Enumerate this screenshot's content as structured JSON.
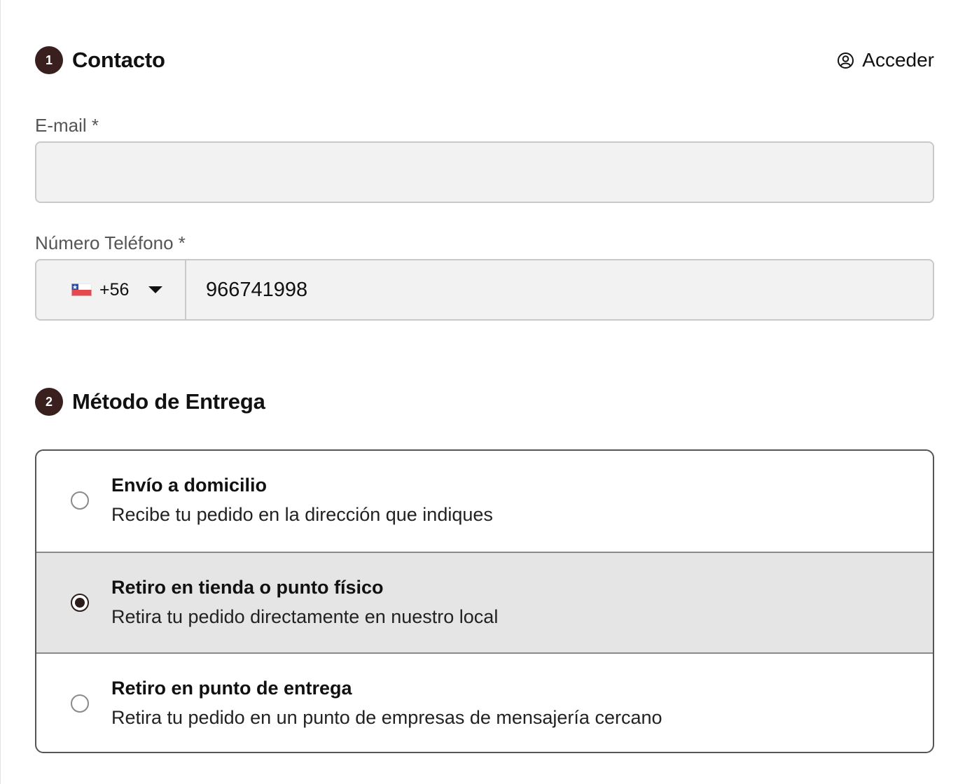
{
  "contact": {
    "step": "1",
    "title": "Contacto",
    "login_label": "Acceder"
  },
  "email": {
    "label": "E-mail *",
    "value": "",
    "placeholder": ""
  },
  "phone": {
    "label": "Número Teléfono *",
    "country_code": "+56",
    "country_flag": "chile-flag-icon",
    "value": "966741998"
  },
  "delivery": {
    "step": "2",
    "title": "Método de Entrega",
    "options": [
      {
        "title": "Envío a domicilio",
        "description": "Recibe tu pedido en la dirección que indiques",
        "selected": false
      },
      {
        "title": "Retiro en tienda o punto físico",
        "description": "Retira tu pedido directamente en nuestro local",
        "selected": true
      },
      {
        "title": "Retiro en punto de entrega",
        "description": "Retira tu pedido en un punto de empresas de mensajería cercano",
        "selected": false
      }
    ]
  },
  "colors": {
    "badge": "#3a1f1f",
    "input_bg": "#f2f2f2",
    "selected_bg": "#e5e5e5"
  }
}
